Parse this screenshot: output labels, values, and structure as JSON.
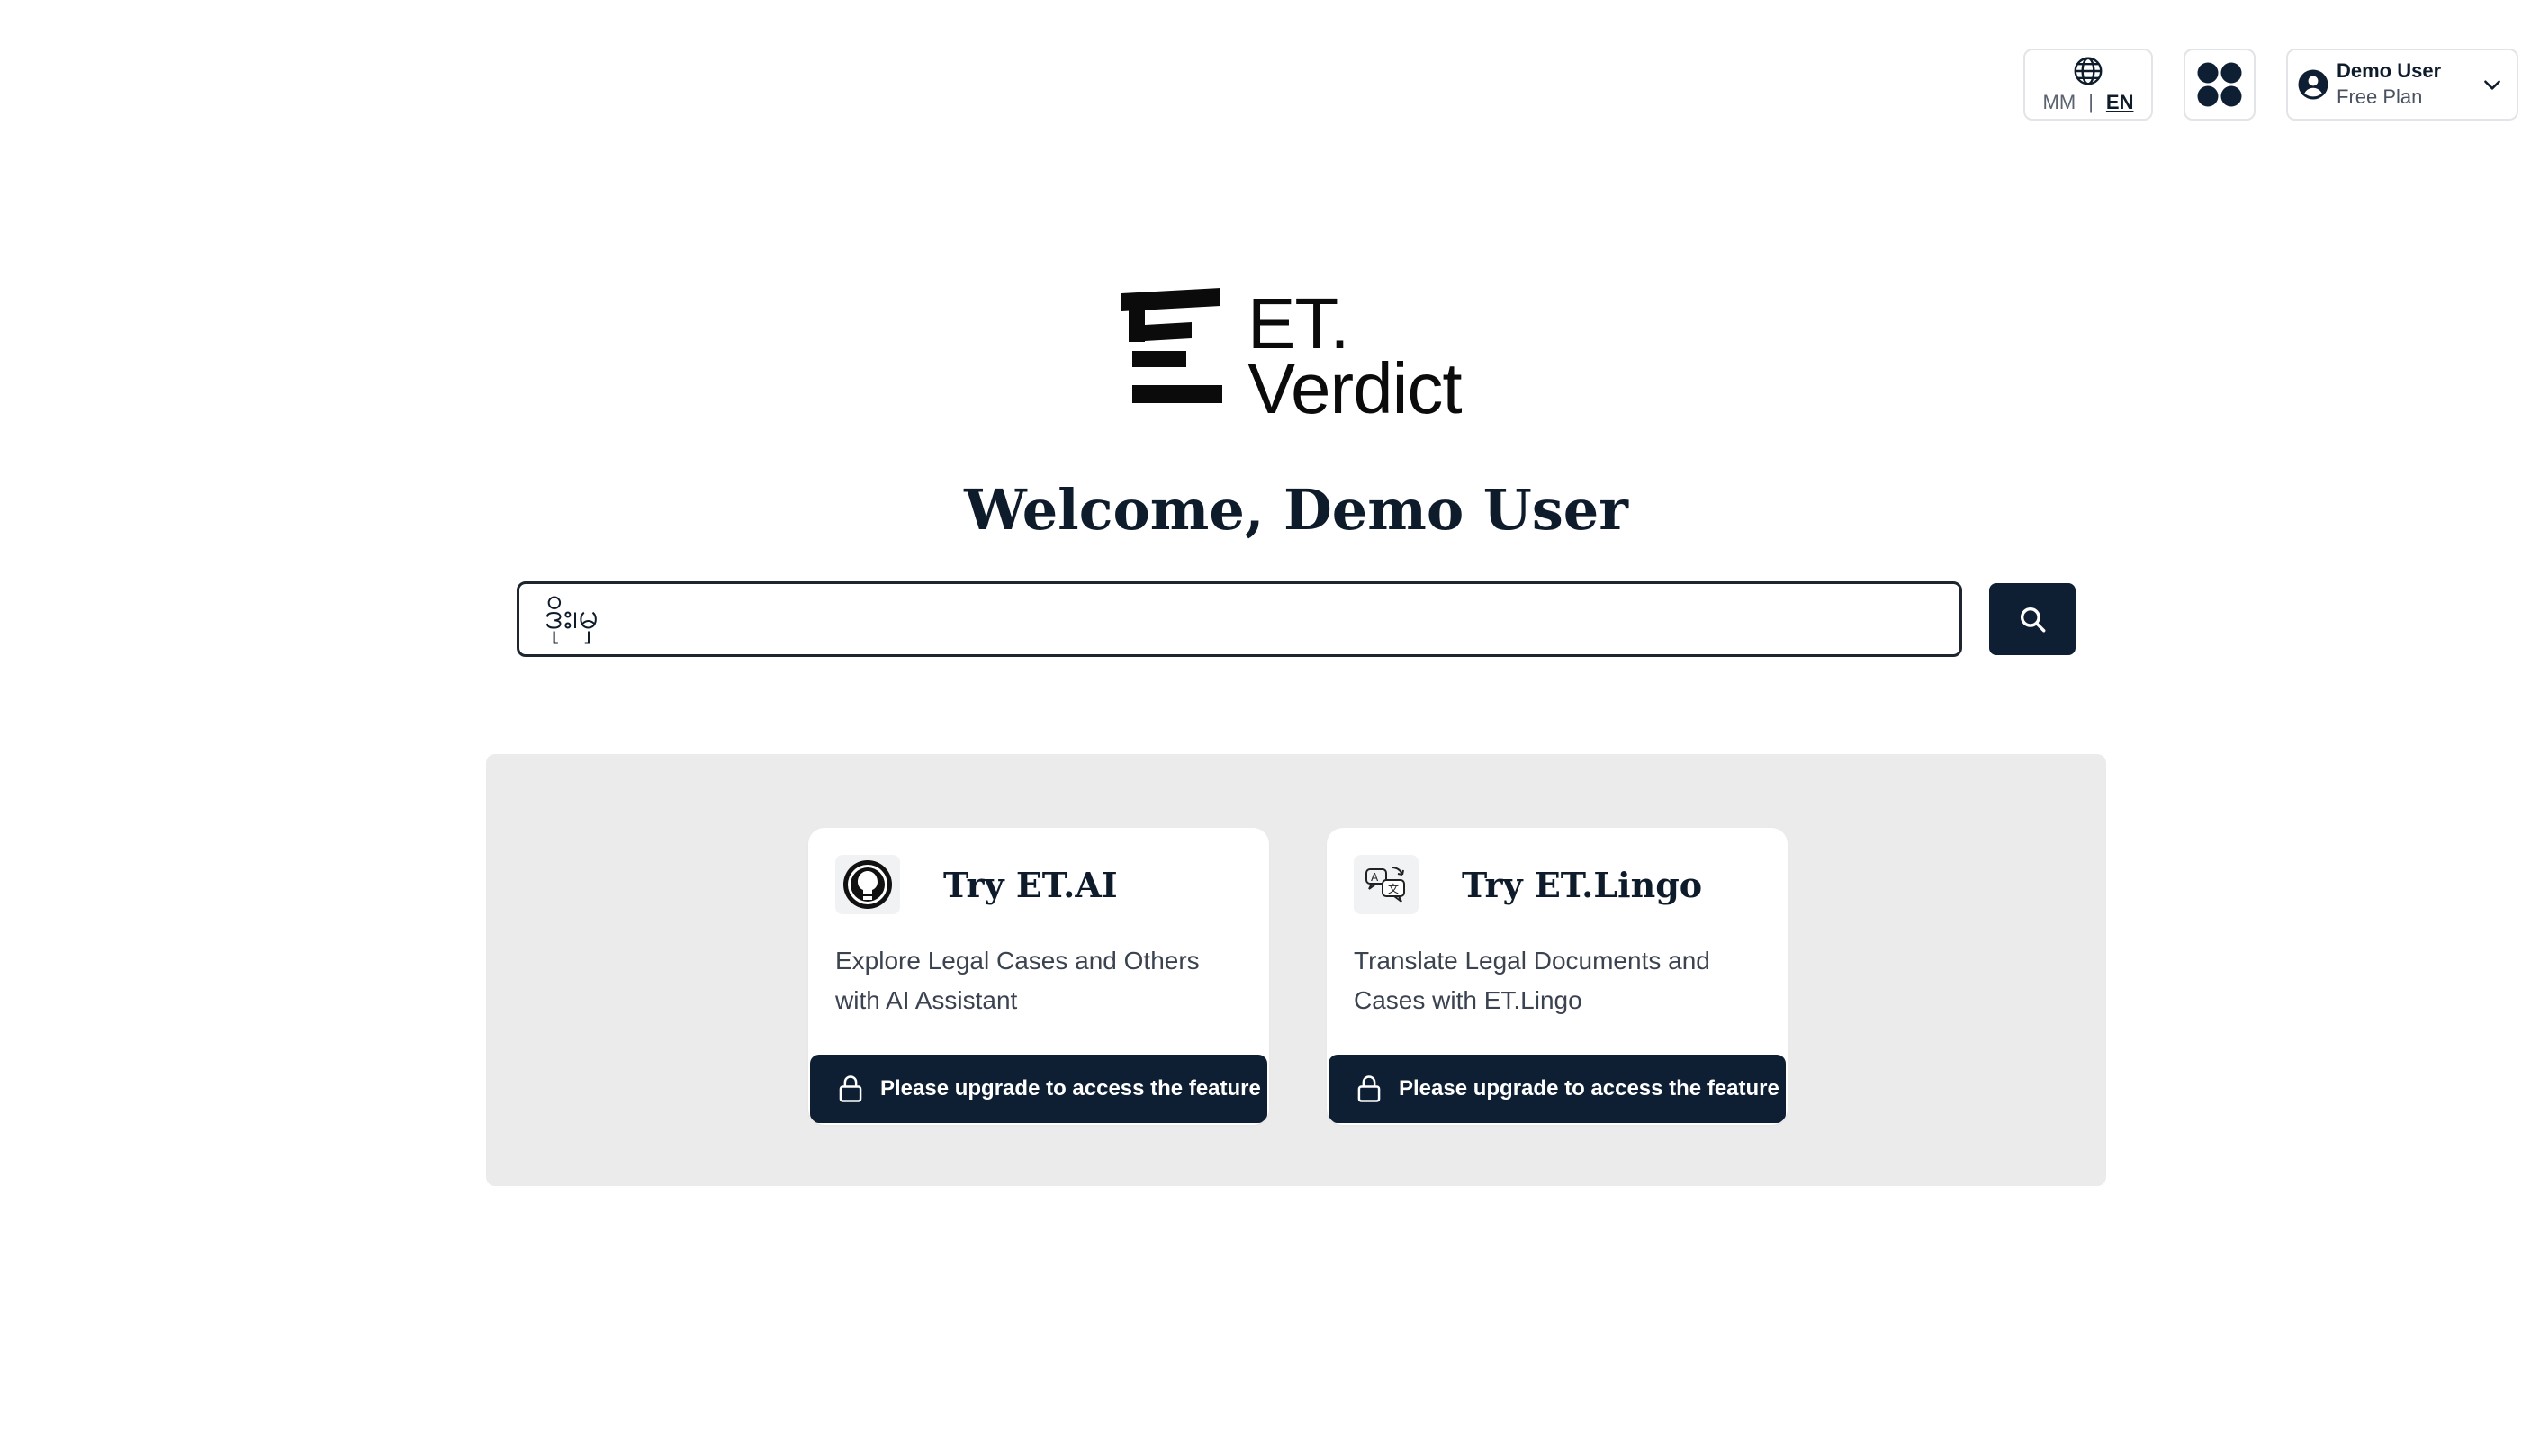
{
  "header": {
    "language": {
      "options": [
        "MM",
        "EN"
      ],
      "separator": "|",
      "active": "EN"
    },
    "apps_icon": "apps-grid-icon",
    "user": {
      "name": "Demo User",
      "plan": "Free Plan"
    }
  },
  "logo": {
    "line1": "ET.",
    "line2": "Verdict"
  },
  "welcome": "Welcome, Demo User",
  "search": {
    "value": "ဒိုး၊မှ",
    "icon": "search-icon"
  },
  "cards": [
    {
      "title": "Try ET.AI",
      "description": "Explore Legal Cases and Others with AI Assistant",
      "button_label": "Please upgrade to access the feature",
      "icon": "ai-assistant-icon"
    },
    {
      "title": "Try ET.Lingo",
      "description": "Translate Legal Documents and Cases with ET.Lingo",
      "button_label": "Please upgrade to access the feature",
      "icon": "translate-icon"
    }
  ],
  "colors": {
    "primary": "#0f1f33",
    "panel_bg": "#ebebeb",
    "text": "#0d1b2a"
  }
}
